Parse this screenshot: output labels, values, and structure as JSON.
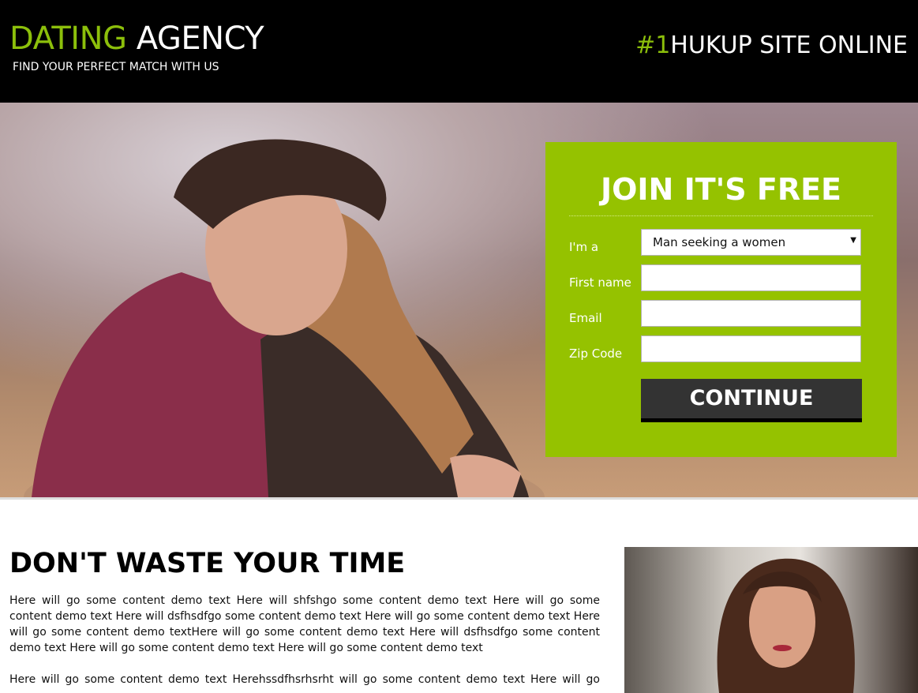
{
  "header": {
    "logo_part1": "DATING",
    "logo_part2": " AGENCY",
    "tagline": "FIND YOUR PERFECT MATCH WITH US",
    "slogan_part1": "#1",
    "slogan_part2": "HUKUP SITE ONLINE"
  },
  "form": {
    "title": "JOIN IT'S FREE",
    "fields": [
      {
        "label": "I'm a",
        "value": "Man seeking a women"
      },
      {
        "label": "First name",
        "value": ""
      },
      {
        "label": "Email",
        "value": ""
      },
      {
        "label": "Zip Code",
        "value": ""
      }
    ],
    "button": "CONTINUE"
  },
  "content": {
    "title": "DON'T WASTE YOUR TIME",
    "paragraphs": [
      "Here will go some content demo text Here will shfshgo some content demo text Here will go some content demo text Here will dsfhsdfgo some content demo text Here will go some content demo text Here will go some content demo textHere will go some content demo text Here will dsfhsdfgo some content demo text Here will go some content demo text Here will go some content demo text",
      "Here will go some content demo text Herehssdfhsrhsrht will go some content demo text Here will go"
    ]
  },
  "colors": {
    "accent": "#95c200",
    "header_bg": "#000000",
    "button": "#333333"
  }
}
